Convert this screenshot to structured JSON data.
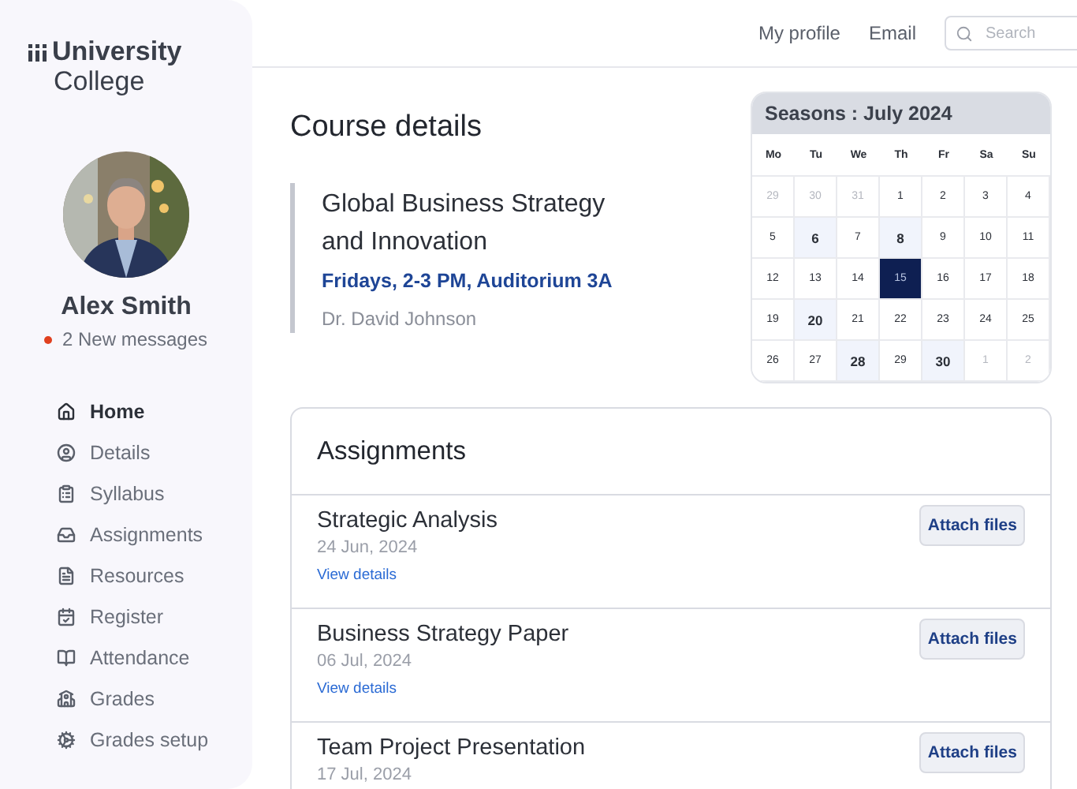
{
  "brand": {
    "line1": "University",
    "line2": "College"
  },
  "profile": {
    "name": "Alex Smith",
    "messages": "2 New messages",
    "has_unread": true
  },
  "nav": [
    {
      "label": "Home",
      "selected": true
    },
    {
      "label": "Details",
      "selected": false
    },
    {
      "label": "Syllabus",
      "selected": false
    },
    {
      "label": "Assignments",
      "selected": false
    },
    {
      "label": "Resources",
      "selected": false
    },
    {
      "label": "Register",
      "selected": false
    },
    {
      "label": "Attendance",
      "selected": false
    },
    {
      "label": "Grades",
      "selected": false
    },
    {
      "label": "Grades setup",
      "selected": false
    }
  ],
  "header": {
    "links": [
      "My profile",
      "Email"
    ],
    "search": {
      "placeholder": "Search"
    }
  },
  "page_title": "Course details",
  "course": {
    "title": "Global Business Strategy and Innovation",
    "schedule": "Fridays, 2-3 PM, Auditorium 3A",
    "instructor": "Dr. David Johnson"
  },
  "calendar": {
    "title": "Seasons : July 2024",
    "weekdays": [
      "Mo",
      "Tu",
      "We",
      "Th",
      "Fr",
      "Sa",
      "Su"
    ],
    "days": [
      {
        "label": "29",
        "kind": "outside",
        "selected": false
      },
      {
        "label": "30",
        "kind": "outside",
        "selected": false
      },
      {
        "label": "31",
        "kind": "outside",
        "selected": false
      },
      {
        "label": "1",
        "kind": "plain",
        "selected": false
      },
      {
        "label": "2",
        "kind": "plain",
        "selected": false
      },
      {
        "label": "3",
        "kind": "plain",
        "selected": false
      },
      {
        "label": "4",
        "kind": "plain",
        "selected": false
      },
      {
        "label": "5",
        "kind": "plain",
        "selected": false
      },
      {
        "label": "6",
        "kind": "event",
        "selected": false
      },
      {
        "label": "7",
        "kind": "plain",
        "selected": false
      },
      {
        "label": "8",
        "kind": "event",
        "selected": false
      },
      {
        "label": "9",
        "kind": "plain",
        "selected": false
      },
      {
        "label": "10",
        "kind": "plain",
        "selected": false
      },
      {
        "label": "11",
        "kind": "plain",
        "selected": false
      },
      {
        "label": "12",
        "kind": "plain",
        "selected": false
      },
      {
        "label": "13",
        "kind": "plain",
        "selected": false
      },
      {
        "label": "14",
        "kind": "plain",
        "selected": false
      },
      {
        "label": "15",
        "kind": "plain",
        "selected": true
      },
      {
        "label": "16",
        "kind": "plain",
        "selected": false
      },
      {
        "label": "17",
        "kind": "plain",
        "selected": false
      },
      {
        "label": "18",
        "kind": "plain",
        "selected": false
      },
      {
        "label": "19",
        "kind": "plain",
        "selected": false
      },
      {
        "label": "20",
        "kind": "event",
        "selected": false
      },
      {
        "label": "21",
        "kind": "plain",
        "selected": false
      },
      {
        "label": "22",
        "kind": "plain",
        "selected": false
      },
      {
        "label": "23",
        "kind": "plain",
        "selected": false
      },
      {
        "label": "24",
        "kind": "plain",
        "selected": false
      },
      {
        "label": "25",
        "kind": "plain",
        "selected": false
      },
      {
        "label": "26",
        "kind": "plain",
        "selected": false
      },
      {
        "label": "27",
        "kind": "plain",
        "selected": false
      },
      {
        "label": "28",
        "kind": "event",
        "selected": false
      },
      {
        "label": "29",
        "kind": "plain",
        "selected": false
      },
      {
        "label": "30",
        "kind": "event",
        "selected": false
      },
      {
        "label": "1",
        "kind": "outside",
        "selected": false
      },
      {
        "label": "2",
        "kind": "outside",
        "selected": false
      }
    ]
  },
  "assignments": {
    "title": "Assignments",
    "items": [
      {
        "title": "Strategic Analysis",
        "date": "24 Jun, 2024",
        "link": "View details",
        "action": "Attach files"
      },
      {
        "title": "Business Strategy Paper",
        "date": "06 Jul, 2024",
        "link": "View details",
        "action": "Attach files"
      },
      {
        "title": "Team Project Presentation",
        "date": "17 Jul, 2024",
        "action": "Attach files"
      }
    ]
  }
}
